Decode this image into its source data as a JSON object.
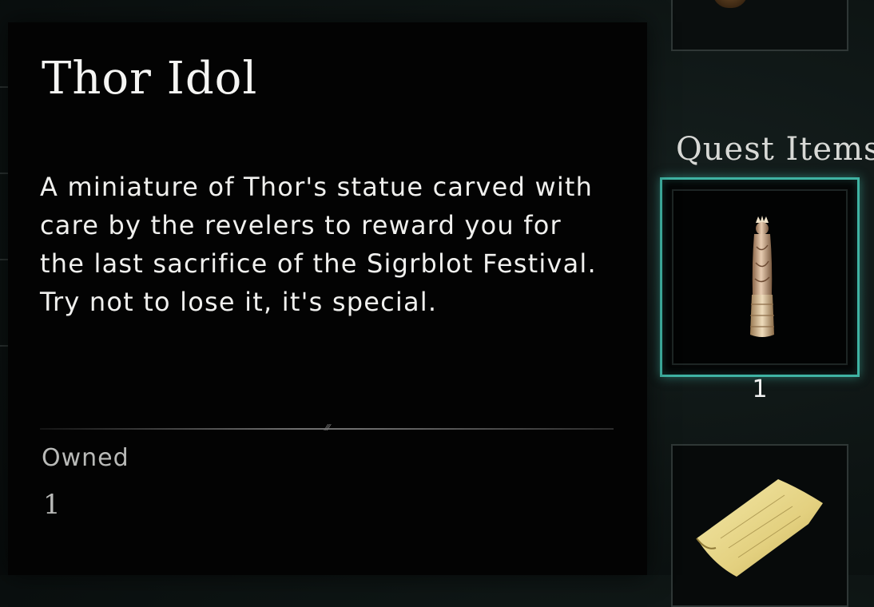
{
  "item": {
    "title": "Thor Idol",
    "description": "A miniature of Thor's statue carved with care by the revelers to reward you for the last sacrifice of the Sigrblot Festival. Try not to lose it, it's special.",
    "owned_label": "Owned",
    "owned_value": "1"
  },
  "inventory": {
    "section_title": "Quest Items",
    "selected_slot": {
      "icon": "thor-idol-icon",
      "count": "1"
    },
    "other_slots": [
      {
        "icon": "item-thumbnail-icon"
      },
      {
        "icon": "scroll-map-icon"
      }
    ]
  },
  "colors": {
    "panel_bg": "#030303",
    "selection_accent": "#3fb3a3",
    "muted_text": "#b9bab8"
  }
}
